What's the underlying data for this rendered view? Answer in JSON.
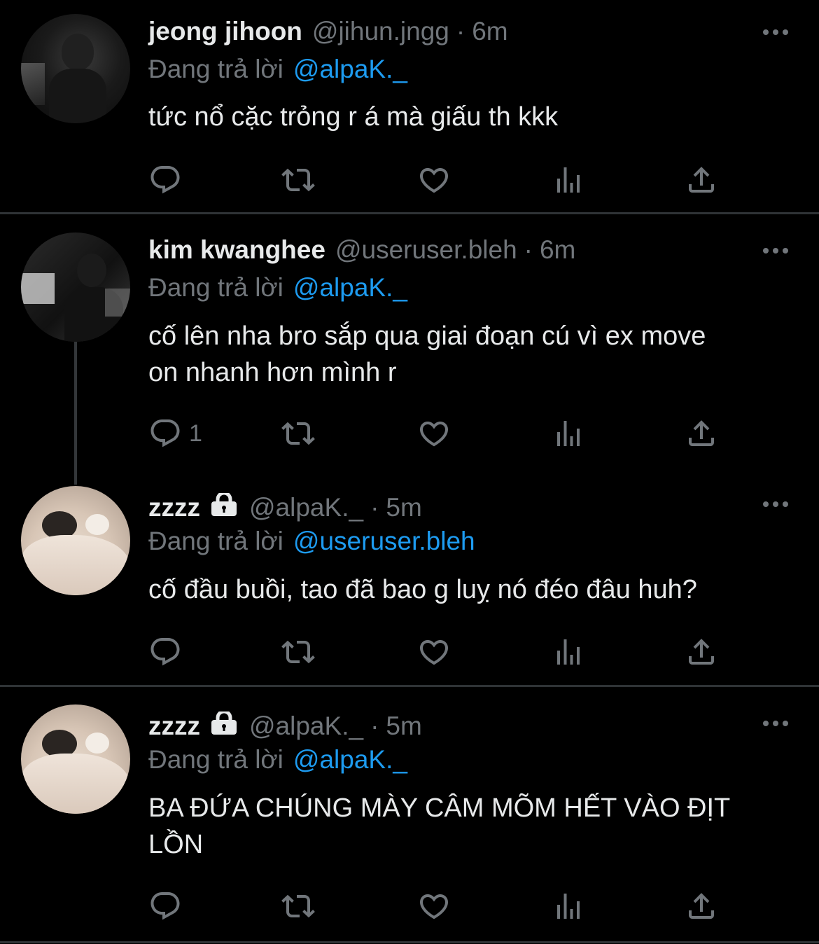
{
  "tweets": [
    {
      "name": "jeong jihoon",
      "handle": "@jihun.jngg",
      "dot": "·",
      "time": "6m",
      "reply_prefix": "Đang trả lời",
      "reply_to": "@alpaK._",
      "text": "tức nổ cặc trỏng r á mà giấu th kkk",
      "reply_count": "",
      "locked": false
    },
    {
      "name": "kim kwanghee",
      "handle": "@useruser.bleh",
      "dot": "·",
      "time": "6m",
      "reply_prefix": "Đang trả lời",
      "reply_to": "@alpaK._",
      "text": "cố lên nha bro sắp qua giai đoạn cú vì ex move on nhanh hơn mình r",
      "reply_count": "1",
      "locked": false
    },
    {
      "name": "zzzz",
      "handle": "@alpaK._",
      "dot": "·",
      "time": "5m",
      "reply_prefix": "Đang trả lời",
      "reply_to": "@useruser.bleh",
      "text": "cố đầu buồi, tao đã bao g luỵ nó đéo đâu huh?",
      "reply_count": "",
      "locked": true
    },
    {
      "name": "zzzz",
      "handle": "@alpaK._",
      "dot": "·",
      "time": "5m",
      "reply_prefix": "Đang trả lời",
      "reply_to": "@alpaK._",
      "text": "BA ĐỨA CHÚNG MÀY CÂM MÕM HẾT VÀO ĐỊT LỒN",
      "reply_count": "",
      "locked": true
    }
  ],
  "icons": {
    "reply": "reply-icon",
    "retweet": "retweet-icon",
    "like": "heart-icon",
    "views": "views-icon",
    "share": "share-icon",
    "more": "more-icon",
    "lock": "lock-icon"
  },
  "colors": {
    "background": "#000000",
    "text": "#e7e9ea",
    "muted": "#71767b",
    "accent": "#1d9bf0"
  }
}
